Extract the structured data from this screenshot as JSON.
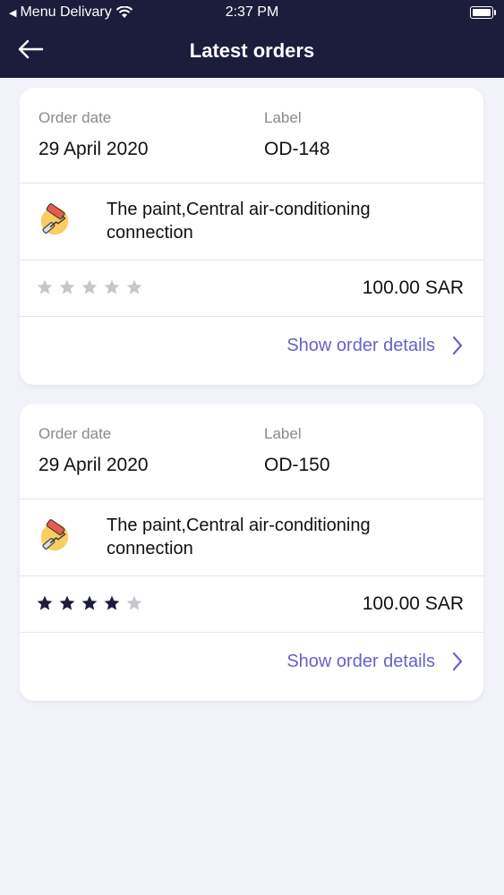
{
  "status_bar": {
    "back_app_label": "Menu Delivary",
    "time": "2:37 PM"
  },
  "header": {
    "title": "Latest orders",
    "back_icon": "arrow-left-icon"
  },
  "labels": {
    "order_date": "Order date",
    "label": "Label",
    "show_details": "Show order details"
  },
  "orders": [
    {
      "order_date": "29 April 2020",
      "label": "OD-148",
      "service": "The paint,Central air-conditioning connection",
      "service_icon": "paint-roller-icon",
      "rating": 0,
      "rating_max": 5,
      "price": "100.00 SAR"
    },
    {
      "order_date": "29 April 2020",
      "label": "OD-150",
      "service": "The paint,Central air-conditioning connection",
      "service_icon": "paint-roller-icon",
      "rating": 4,
      "rating_max": 5,
      "price": "100.00 SAR"
    }
  ],
  "colors": {
    "header_bg": "#1c1c3c",
    "accent": "#6a60c8",
    "star_filled": "#1c1c3c",
    "star_empty": "#c6c6cc"
  }
}
